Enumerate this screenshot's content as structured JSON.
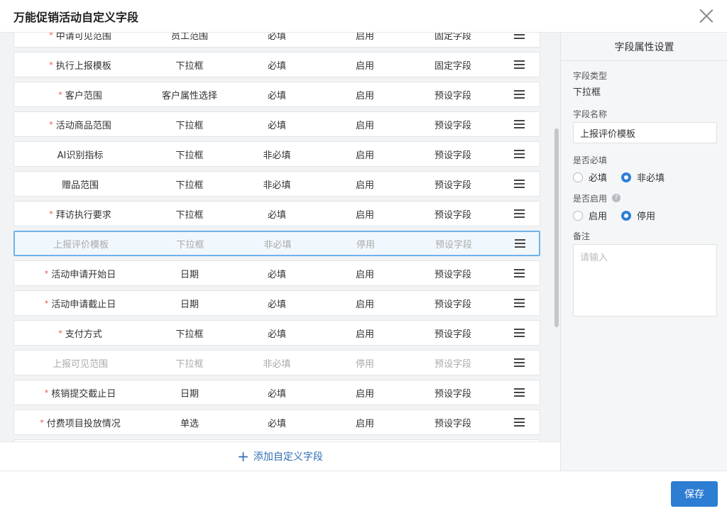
{
  "dialog": {
    "title": "万能促销活动自定义字段"
  },
  "rows": [
    {
      "name": "中请可见范围",
      "type": "员工范围",
      "required": "必填",
      "enabled": "启用",
      "kind": "固定字段",
      "star": true,
      "disabled": false,
      "selected": false
    },
    {
      "name": "执行上报模板",
      "type": "下拉框",
      "required": "必填",
      "enabled": "启用",
      "kind": "固定字段",
      "star": true,
      "disabled": false,
      "selected": false
    },
    {
      "name": "客户范围",
      "type": "客户属性选择",
      "required": "必填",
      "enabled": "启用",
      "kind": "预设字段",
      "star": true,
      "disabled": false,
      "selected": false
    },
    {
      "name": "活动商品范围",
      "type": "下拉框",
      "required": "必填",
      "enabled": "启用",
      "kind": "预设字段",
      "star": true,
      "disabled": false,
      "selected": false
    },
    {
      "name": "AI识别指标",
      "type": "下拉框",
      "required": "非必填",
      "enabled": "启用",
      "kind": "预设字段",
      "star": false,
      "disabled": false,
      "selected": false
    },
    {
      "name": "赠品范围",
      "type": "下拉框",
      "required": "非必填",
      "enabled": "启用",
      "kind": "预设字段",
      "star": false,
      "disabled": false,
      "selected": false
    },
    {
      "name": "拜访执行要求",
      "type": "下拉框",
      "required": "必填",
      "enabled": "启用",
      "kind": "预设字段",
      "star": true,
      "disabled": false,
      "selected": false
    },
    {
      "name": "上报评价模板",
      "type": "下拉框",
      "required": "非必填",
      "enabled": "停用",
      "kind": "预设字段",
      "star": false,
      "disabled": true,
      "selected": true
    },
    {
      "name": "活动申请开始日",
      "type": "日期",
      "required": "必填",
      "enabled": "启用",
      "kind": "预设字段",
      "star": true,
      "disabled": false,
      "selected": false
    },
    {
      "name": "活动申请截止日",
      "type": "日期",
      "required": "必填",
      "enabled": "启用",
      "kind": "预设字段",
      "star": true,
      "disabled": false,
      "selected": false
    },
    {
      "name": "支付方式",
      "type": "下拉框",
      "required": "必填",
      "enabled": "启用",
      "kind": "预设字段",
      "star": true,
      "disabled": false,
      "selected": false
    },
    {
      "name": "上报可见范围",
      "type": "下拉框",
      "required": "非必填",
      "enabled": "停用",
      "kind": "预设字段",
      "star": false,
      "disabled": true,
      "selected": false
    },
    {
      "name": "核销提交截止日",
      "type": "日期",
      "required": "必填",
      "enabled": "启用",
      "kind": "预设字段",
      "star": true,
      "disabled": false,
      "selected": false
    },
    {
      "name": "付费项目投放情况",
      "type": "单选",
      "required": "必填",
      "enabled": "启用",
      "kind": "预设字段",
      "star": true,
      "disabled": false,
      "selected": false
    },
    {
      "name": "",
      "type": "",
      "required": "",
      "enabled": "",
      "kind": "",
      "star": false,
      "disabled": false,
      "selected": false
    }
  ],
  "add_field": {
    "icon": "+",
    "label": "添加自定义字段"
  },
  "panel": {
    "title": "字段属性设置",
    "type_label": "字段类型",
    "type_value": "下拉框",
    "name_label": "字段名称",
    "name_value": "上报评价模板",
    "required_label": "是否必填",
    "required_options": [
      "必填",
      "非必填"
    ],
    "enabled_label": "是否启用",
    "help_icon": "?",
    "enabled_options": [
      "启用",
      "停用"
    ],
    "remark_label": "备注",
    "remark_placeholder": "请输入"
  },
  "footer": {
    "save_label": "保存"
  },
  "colors": {
    "primary": "#2d7dd2",
    "selected_border": "#6fb3ea",
    "required_star": "#e8524a",
    "link": "#2f6fb5"
  }
}
